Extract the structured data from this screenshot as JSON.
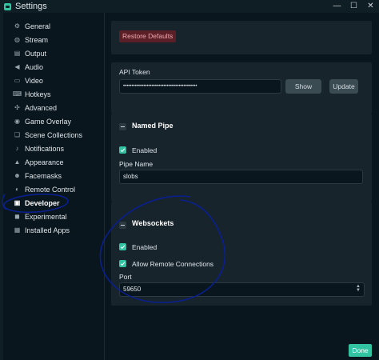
{
  "window": {
    "title": "Settings",
    "controls": {
      "minimize": "—",
      "maximize": "☐",
      "close": "✕"
    }
  },
  "sidebar": {
    "items": [
      {
        "label": "General",
        "icon": "gear-icon",
        "glyph": "⚙"
      },
      {
        "label": "Stream",
        "icon": "globe-icon",
        "glyph": "◍"
      },
      {
        "label": "Output",
        "icon": "output-icon",
        "glyph": "▤"
      },
      {
        "label": "Audio",
        "icon": "speaker-icon",
        "glyph": "◀"
      },
      {
        "label": "Video",
        "icon": "video-icon",
        "glyph": "▭"
      },
      {
        "label": "Hotkeys",
        "icon": "keyboard-icon",
        "glyph": "⌨"
      },
      {
        "label": "Advanced",
        "icon": "wrench-icon",
        "glyph": "✣"
      },
      {
        "label": "Game Overlay",
        "icon": "gamepad-icon",
        "glyph": "◉"
      },
      {
        "label": "Scene Collections",
        "icon": "collections-icon",
        "glyph": "❏"
      },
      {
        "label": "Notifications",
        "icon": "bell-icon",
        "glyph": "♪"
      },
      {
        "label": "Appearance",
        "icon": "paint-icon",
        "glyph": "▲"
      },
      {
        "label": "Facemasks",
        "icon": "mask-icon",
        "glyph": "☻"
      },
      {
        "label": "Remote Control",
        "icon": "remote-icon",
        "glyph": "◐"
      },
      {
        "label": "Developer",
        "icon": "developer-icon",
        "glyph": "▣"
      },
      {
        "label": "Experimental",
        "icon": "flask-icon",
        "glyph": "◼"
      },
      {
        "label": "Installed Apps",
        "icon": "apps-icon",
        "glyph": "▦"
      }
    ],
    "active": "Developer"
  },
  "main": {
    "restore_defaults": "Restore Defaults",
    "api": {
      "label": "API Token",
      "value": "••••••••••••••••••••••••••••••••••••••••••••",
      "show": "Show",
      "update": "Update"
    },
    "named_pipe": {
      "title": "Named Pipe",
      "enabled_label": "Enabled",
      "enabled": true,
      "pipe_name_label": "Pipe Name",
      "pipe_name_value": "slobs"
    },
    "websockets": {
      "title": "Websockets",
      "enabled_label": "Enabled",
      "enabled": true,
      "allow_remote_label": "Allow Remote Connections",
      "allow_remote": true,
      "port_label": "Port",
      "port_value": "59650"
    }
  },
  "footer": {
    "done": "Done"
  },
  "colors": {
    "accent": "#31c3a2",
    "danger_bg": "#5a1f27",
    "annotation": "#0a1f8f"
  }
}
